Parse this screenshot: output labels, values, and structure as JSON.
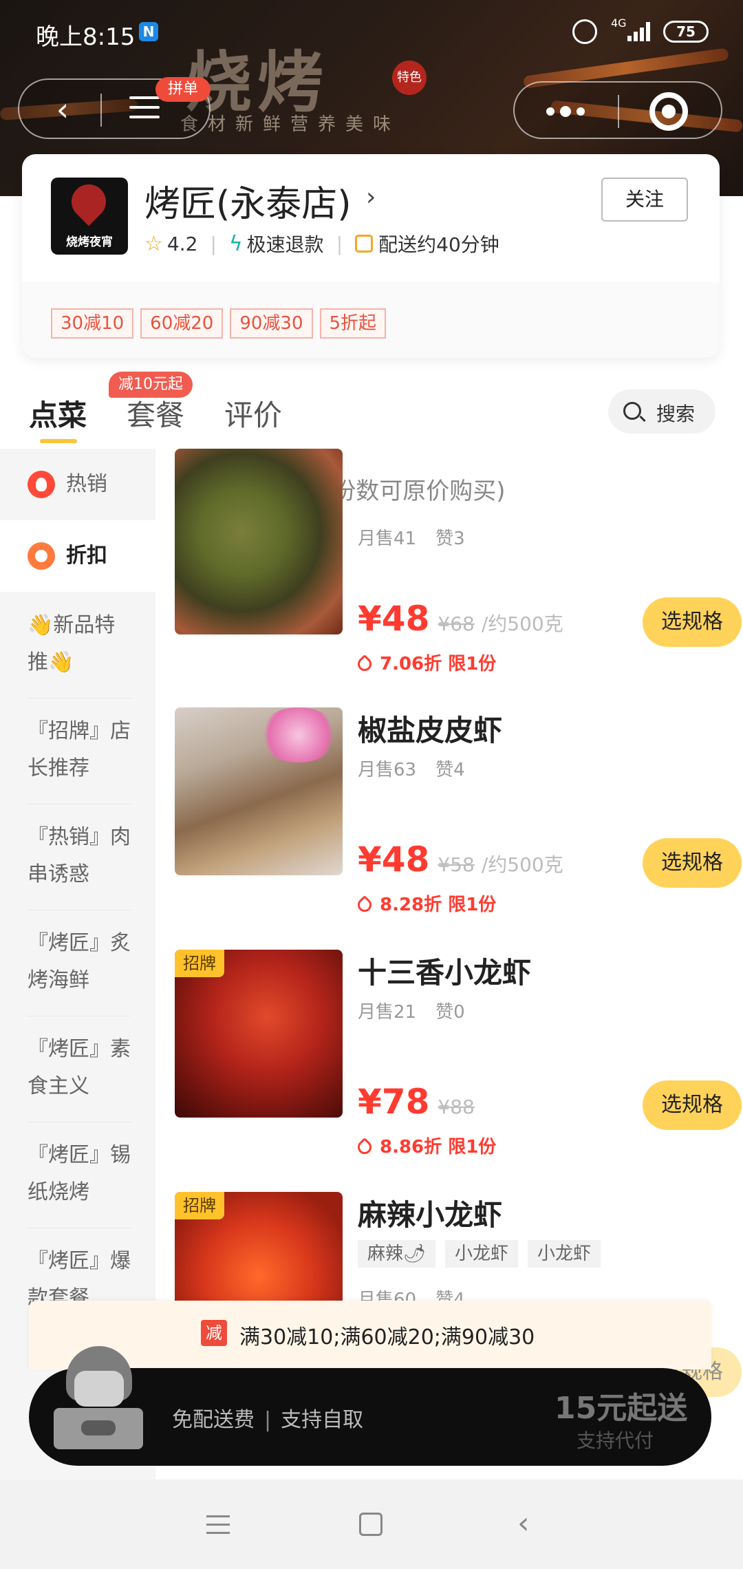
{
  "status_bar": {
    "time": "晚上8:15",
    "app_badge": "N",
    "network": "4G",
    "battery": "75"
  },
  "banner": {
    "deco_title": "烧烤",
    "deco_subtitle": "食材新鲜营养美味",
    "stamp": "特色"
  },
  "nav": {
    "back_glyph": "‹",
    "pin_badge": "拼单"
  },
  "store": {
    "logo_text": "烧烤夜宵",
    "name": "烤匠(永泰店)",
    "arrow": "›",
    "follow_label": "关注",
    "rating": "4.2",
    "refund": "极速退款",
    "delivery": "配送约40分钟",
    "discounts": [
      "30减10",
      "60减20",
      "90减30",
      "5折起"
    ]
  },
  "tabs": {
    "items": [
      "点菜",
      "套餐",
      "评价"
    ],
    "badge": "减10元起",
    "search_label": "搜索"
  },
  "sidebar": {
    "items": [
      {
        "label": "热销"
      },
      {
        "label": "折扣"
      },
      {
        "label": "👋新品特推👋"
      },
      {
        "label": "『招牌』店长推荐"
      },
      {
        "label": "『热销』肉串诱惑"
      },
      {
        "label": "『烤匠』炙烤海鲜"
      },
      {
        "label": "『烤匠』素食主义"
      },
      {
        "label": "『烤匠』锡纸烧烤"
      },
      {
        "label": "『烤匠』爆款套餐"
      }
    ]
  },
  "section": {
    "title": "折扣",
    "note": "(超过限购份数可原价购买)"
  },
  "dishes": [
    {
      "name": "",
      "monthly_sales": "月售41",
      "likes": "赞3",
      "price": "¥48",
      "orig_price": "¥68",
      "unit": "/约500克",
      "discount": "7.06折 限1份",
      "button": "选规格"
    },
    {
      "name": "椒盐皮皮虾",
      "monthly_sales": "月售63",
      "likes": "赞4",
      "price": "¥48",
      "orig_price": "¥58",
      "unit": "/约500克",
      "discount": "8.28折 限1份",
      "button": "选规格"
    },
    {
      "name": "十三香小龙虾",
      "monthly_sales": "月售21",
      "likes": "赞0",
      "price": "¥78",
      "orig_price": "¥88",
      "unit": "",
      "discount": "8.86折 限1份",
      "badge": "招牌",
      "button": "选规格"
    },
    {
      "name": "麻辣小龙虾",
      "tags": [
        "麻辣🌶",
        "小龙虾",
        "小龙虾"
      ],
      "monthly_sales": "月售60",
      "likes": "赞4",
      "badge": "招牌",
      "button": "选规格"
    }
  ],
  "promo": {
    "icon": "减",
    "text": "满30减10;满60减20;满90减30"
  },
  "cart": {
    "free_delivery": "免配送费",
    "divider": "|",
    "self_pickup": "支持自取",
    "min_order": "15元起送",
    "proxy": "支持代付"
  },
  "colors": {
    "accent": "#ffd25a",
    "price_red": "#ff3b30",
    "tab_underline": "#f8c53a"
  }
}
